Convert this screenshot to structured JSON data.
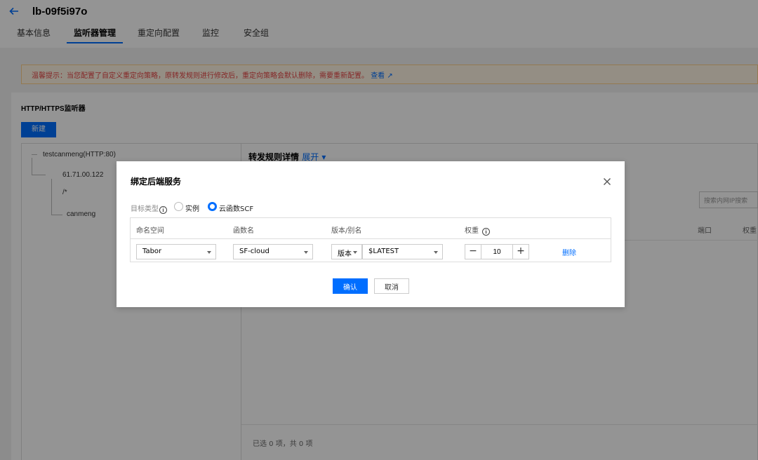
{
  "colors": {
    "accent": "#006eff",
    "notice_text": "#e54545",
    "overlay": "rgba(0,0,0,0.42)"
  },
  "header": {
    "back_icon": "arrow-left-icon",
    "title": "lb-09f5i97o",
    "tabs": [
      "基本信息",
      "监听器管理",
      "重定向配置",
      "监控",
      "安全组"
    ],
    "active_tab": "监听器管理"
  },
  "notice": {
    "text": "温馨提示：当您配置了自定义重定向策略，原转发规则进行修改后，重定向策略会默认删除，需要重新配置。",
    "link": "查看"
  },
  "listeners": {
    "section_title": "HTTP/HTTPS监听器",
    "new_button": "新建",
    "tree": {
      "listener": "testcanmeng(HTTP:80)",
      "domain": "61.71.00.122",
      "path": "/*",
      "target": "canmeng"
    }
  },
  "rules": {
    "title": "转发规则详情",
    "expand": "展开",
    "search_placeholder": "搜索内网IP搜索",
    "columns": {
      "port": "端口",
      "weight": "权重"
    },
    "footer": "已选 0 项，共 0 项"
  },
  "modal": {
    "title": "绑定后端服务",
    "close_icon": "close-icon",
    "target_type_label": "目标类型",
    "target_types": [
      {
        "label": "实例",
        "checked": false
      },
      {
        "label": "云函数SCF",
        "checked": true
      }
    ],
    "table": {
      "headers": [
        "命名空间",
        "函数名",
        "版本/别名",
        "权重"
      ],
      "row": {
        "namespace": "Tabor",
        "function": "SF-cloud",
        "version_type": "版本",
        "version": "$LATEST",
        "weight": "10",
        "delete": "删除"
      }
    },
    "confirm": "确认",
    "cancel": "取消"
  }
}
